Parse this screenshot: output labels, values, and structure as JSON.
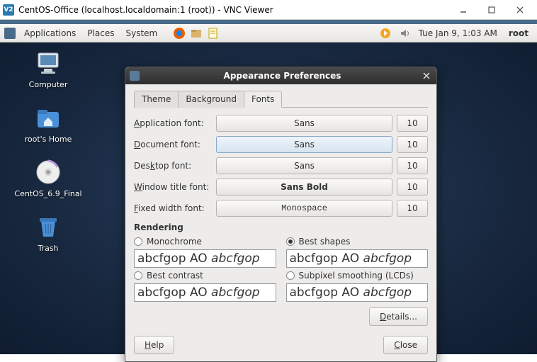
{
  "vnc": {
    "title": "CentOS-Office (localhost.localdomain:1 (root)) - VNC Viewer",
    "logo": "V2"
  },
  "panel": {
    "menus": [
      "Applications",
      "Places",
      "System"
    ],
    "clock": "Tue Jan  9,  1:03 AM",
    "user": "root"
  },
  "desktop_icons": [
    {
      "name": "computer",
      "label": "Computer"
    },
    {
      "name": "home",
      "label": "root's Home"
    },
    {
      "name": "disc",
      "label": "CentOS_6.9_Final"
    },
    {
      "name": "trash",
      "label": "Trash"
    }
  ],
  "dialog": {
    "title": "Appearance Preferences",
    "tabs": [
      "Theme",
      "Background",
      "Fonts"
    ],
    "active_tab": 2,
    "fonts": {
      "application": {
        "label": "Application font:",
        "family": "Sans",
        "size": "10"
      },
      "document": {
        "label": "Document font:",
        "family": "Sans",
        "size": "10"
      },
      "desktop": {
        "label": "Desktop font:",
        "family": "Sans",
        "size": "10"
      },
      "window": {
        "label": "Window title font:",
        "family": "Sans Bold",
        "size": "10"
      },
      "fixed": {
        "label": "Fixed width font:",
        "family": "Monospace",
        "size": "10"
      }
    },
    "rendering": {
      "heading": "Rendering",
      "options": {
        "monochrome": "Monochrome",
        "shapes": "Best shapes",
        "contrast": "Best contrast",
        "subpixel": "Subpixel smoothing (LCDs)"
      },
      "selected": "shapes",
      "sample_plain": "abcfgop AO ",
      "sample_italic": "abcfgop"
    },
    "buttons": {
      "details": "Details...",
      "help": "Help",
      "close": "Close"
    }
  }
}
